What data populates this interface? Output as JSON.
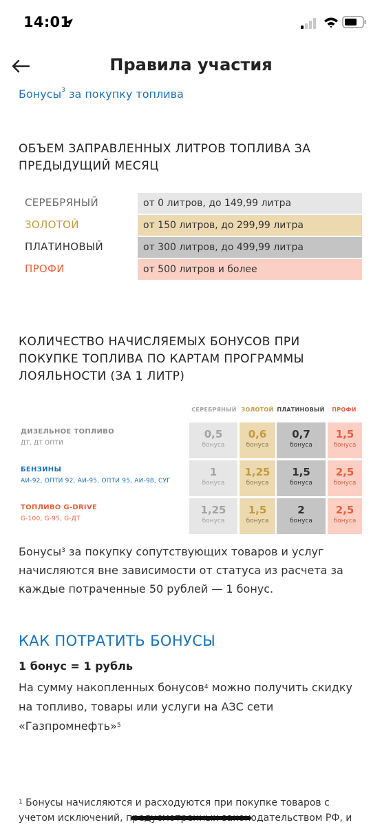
{
  "status_bar": {
    "time": "14:01"
  },
  "nav": {
    "title": "Правила участия"
  },
  "bonus_link": {
    "text": "Бонусы",
    "sup": "3",
    "rest": " за покупку топлива"
  },
  "volume_heading": "ОБЪЕМ ЗАПРАВЛЕННЫХ ЛИТРОВ ТОПЛИВА ЗА ПРЕДЫДУЩИЙ МЕСЯЦ",
  "statuses": [
    {
      "name": "СЕРЕБРЯНЫЙ",
      "range": "от 0 литров, до 149,99 литра",
      "name_color": "#6b6b6b",
      "bg": "#e6e6e6"
    },
    {
      "name": "ЗОЛОТОЙ",
      "range": "от 150 литров, до 299,99 литра",
      "name_color": "#c29a3f",
      "bg": "#ecd9b0"
    },
    {
      "name": "ПЛАТИНОВЫЙ",
      "range": "от 300 литров, до 499,99 литра",
      "name_color": "#333333",
      "bg": "#c4c4c4"
    },
    {
      "name": "ПРОФИ",
      "range": "от 500 литров и более",
      "name_color": "#e8603c",
      "bg": "#fbcfc3"
    }
  ],
  "count_heading": "КОЛИЧЕСТВО НАЧИСЛЯЕМЫХ БОНУСОВ ПРИ ПОКУПКЕ ТОПЛИВА ПО КАРТАМ ПРОГРАММЫ ЛОЯЛЬНОСТИ (ЗА 1 ЛИТР)",
  "bonus_table": {
    "headers": [
      "СЕРЕБРЯНЫЙ",
      "ЗОЛОТОЙ",
      "ПЛАТИНОВЫЙ",
      "ПРОФИ"
    ],
    "unit": "бонуса",
    "rows": [
      {
        "name": "ДИЗЕЛЬНОЕ ТОПЛИВО",
        "sub": "ДТ, ДТ ОПТИ",
        "values": [
          "0,5",
          "0,6",
          "0,7",
          "1,5"
        ]
      },
      {
        "name": "БЕНЗИНЫ",
        "sub": "АИ-92, ОПТИ 92, АИ-95, ОПТИ 95, АИ-98, СУГ",
        "values": [
          "1",
          "1,25",
          "1,5",
          "2,5"
        ]
      },
      {
        "name": "ТОПЛИВО G-DRIVE",
        "sub": "G-100, G-95, G-ДТ",
        "values": [
          "1,25",
          "1,5",
          "2",
          "2,5"
        ]
      }
    ]
  },
  "para1": {
    "word": "Бонусы",
    "sup": "3",
    "rest": " за покупку сопутствующих товаров и услуг начисляются вне зависимости от статуса из расчета за каждые потраченные 50 рублей — 1 бонус."
  },
  "spend_heading": "КАК ПОТРАТИТЬ БОНУСЫ",
  "rate": "1 бонус = 1 рубль",
  "para2": {
    "part1": "На сумму накопленных бонусов",
    "sup1": "4",
    "part2": " можно получить скидку на топливо, товары или услуги на АЗС сети «Газпромнефть»",
    "sup2": "5"
  },
  "footnote": {
    "sup": "1",
    "text": " Бонусы начисляются и расходуются при покупке товаров с учетом исключений, предусмотренных законодательством РФ, и"
  },
  "colors": {
    "link": "#1b72b5",
    "silver": "#a3a3a3",
    "gold": "#c29a3f",
    "platinum": "#444444",
    "profi": "#e8603c",
    "diesel_label": "#8a8a8a",
    "petrol_label": "#1b72b5",
    "gdrive_label": "#e8603c"
  }
}
